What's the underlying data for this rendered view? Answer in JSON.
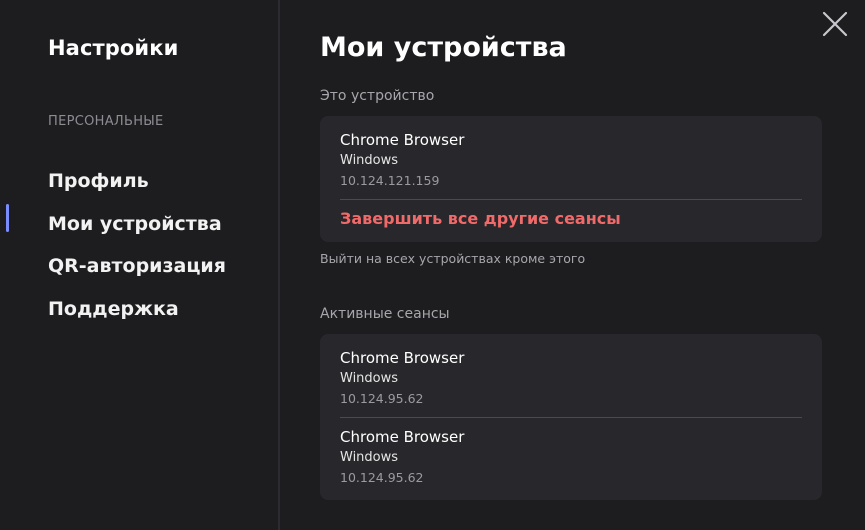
{
  "sidebar": {
    "title": "Настройки",
    "section_label": "ПЕРСОНАЛЬНЫЕ",
    "items": [
      {
        "label": "Профиль"
      },
      {
        "label": "Мои устройства"
      },
      {
        "label": "QR-авторизация"
      },
      {
        "label": "Поддержка"
      }
    ],
    "active_index": 1
  },
  "main": {
    "title": "Мои устройства",
    "this_device": {
      "label": "Это устройство",
      "session": {
        "name": "Chrome Browser",
        "os": "Windows",
        "ip": "10.124.121.159"
      },
      "terminate_label": "Завершить все другие сеансы",
      "hint": "Выйти на всех устройствах кроме этого"
    },
    "active_sessions": {
      "label": "Активные сеансы",
      "sessions": [
        {
          "name": "Chrome Browser",
          "os": "Windows",
          "ip": "10.124.95.62"
        },
        {
          "name": "Chrome Browser",
          "os": "Windows",
          "ip": "10.124.95.62"
        }
      ]
    }
  },
  "icons": {
    "close": "close-icon"
  },
  "colors": {
    "background": "#1d1d20",
    "card": "#28282c",
    "accent": "#7a8cff",
    "danger": "#f06a6a"
  }
}
